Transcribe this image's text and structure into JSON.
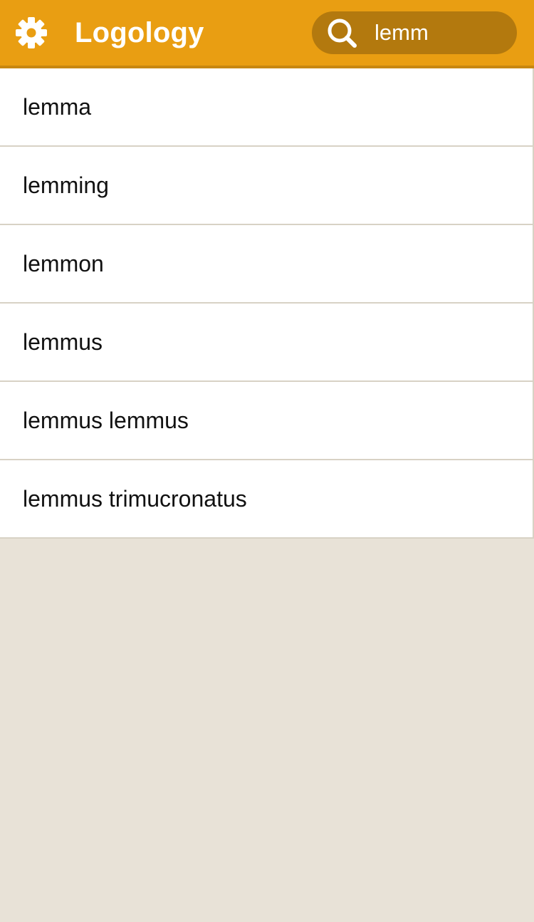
{
  "app": {
    "title": "Logology",
    "colors": {
      "header": "#e99e12",
      "search_bg": "#b3790e",
      "background": "#e8e2d7"
    }
  },
  "header": {
    "settings_icon": "gear-icon",
    "search": {
      "icon": "search-icon",
      "value": "lemm"
    }
  },
  "results": [
    "lemma",
    "lemming",
    "lemmon",
    "lemmus",
    "lemmus lemmus",
    "lemmus trimucronatus"
  ]
}
